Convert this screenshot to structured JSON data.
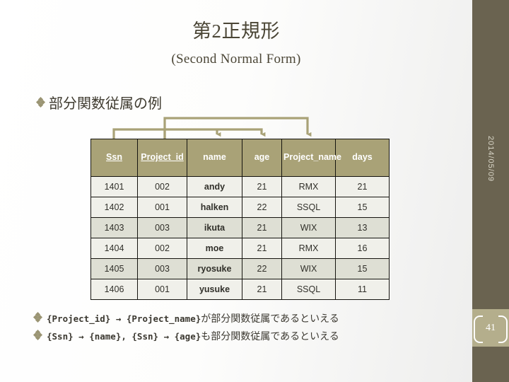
{
  "slide": {
    "title_main": "第2正規形",
    "title_sub": "(Second Normal Form)",
    "headline": "部分関数従属の例"
  },
  "table": {
    "headers": [
      {
        "label": "Ssn",
        "underlined": true
      },
      {
        "label": "Project_id",
        "underlined": true
      },
      {
        "label": "name",
        "underlined": false
      },
      {
        "label": "age",
        "underlined": false
      },
      {
        "label": "Project_name",
        "underlined": false
      },
      {
        "label": "days",
        "underlined": false
      }
    ],
    "rows": [
      {
        "ssn": "1401",
        "project_id": "002",
        "name": "andy",
        "age": "21",
        "project_name": "RMX",
        "days": "21"
      },
      {
        "ssn": "1402",
        "project_id": "001",
        "name": "halken",
        "age": "22",
        "project_name": "SSQL",
        "days": "15"
      },
      {
        "ssn": "1403",
        "project_id": "003",
        "name": "ikuta",
        "age": "21",
        "project_name": "WIX",
        "days": "13"
      },
      {
        "ssn": "1404",
        "project_id": "002",
        "name": "moe",
        "age": "21",
        "project_name": "RMX",
        "days": "16"
      },
      {
        "ssn": "1405",
        "project_id": "003",
        "name": "ryosuke",
        "age": "22",
        "project_name": "WIX",
        "days": "15"
      },
      {
        "ssn": "1406",
        "project_id": "001",
        "name": "yusuke",
        "age": "21",
        "project_name": "SSQL",
        "days": "11"
      }
    ]
  },
  "dependencies": [
    {
      "from": "Ssn",
      "to": "name"
    },
    {
      "from": "Ssn",
      "to": "age"
    },
    {
      "from": "Project_id",
      "to": "name"
    },
    {
      "from": "Project_id",
      "to": "Project_name"
    }
  ],
  "footnotes": [
    {
      "expr": "{Project_id} → {Project_name}",
      "tail": "が部分関数従属であるといえる"
    },
    {
      "expr": "{Ssn} → {name}, {Ssn} → {age}",
      "tail": "も部分関数従属であるといえる"
    }
  ],
  "sidebar": {
    "date": "2014/05/09",
    "page_number": "41"
  },
  "colors": {
    "header_fill": "#a9a277",
    "row_light": "#f0f0ea",
    "row_dark": "#dedfd4",
    "sidebar": "#6a6350",
    "page_box": "#b4ae8c",
    "arrow": "#a9a277",
    "text_dark": "#4b4636"
  }
}
